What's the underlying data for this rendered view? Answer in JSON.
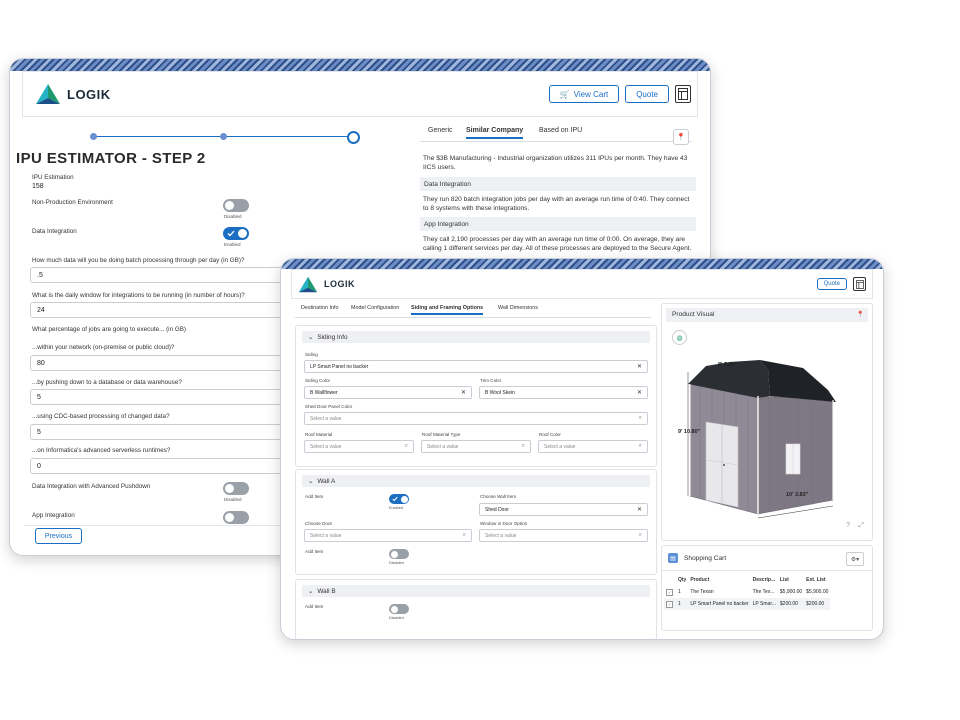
{
  "win1": {
    "brand": "LOGIK",
    "view_cart_label": "View Cart",
    "quote_label": "Quote",
    "title": "IPU ESTIMATOR - STEP 2",
    "ipu_estimation": {
      "label": "IPU Estimation",
      "value": "158"
    },
    "non_prod": {
      "label": "Non-Production Environment",
      "state": "Disabled"
    },
    "data_integration": {
      "label": "Data Integration",
      "state": "Enabled"
    },
    "q1": {
      "label": "How much data will you be doing batch processing through per day (in GB)?",
      "value": ".5"
    },
    "q2": {
      "label": "What is the daily window for integrations to be running (in number of hours)?",
      "value": "24"
    },
    "q3_label": "What percentage of jobs are going to execute... (in GB)",
    "q4": {
      "label": "...within your network (on-premise or public cloud)?",
      "value": "80"
    },
    "q5": {
      "label": "...by pushing down to a database or data warehouse?",
      "value": "5"
    },
    "q6": {
      "label": "...using CDC-based processing of changed data?",
      "value": "5"
    },
    "q7": {
      "label": "...on Informatica's advanced serverless runtimes?",
      "value": "0"
    },
    "adv_pushdown": {
      "label": "Data Integration with Advanced Pushdown",
      "state": "Disabled"
    },
    "app_integration_label": "App Integration",
    "previous_label": "Previous",
    "tabs": [
      "Generic",
      "Similar Company",
      "Based on IPU"
    ],
    "intro": "The $3B Manufacturing - Industrial organization utilizes 311 IPUs per month. They have 43 IICS users.",
    "sec_data_integration": "Data Integration",
    "data_integration_text": "They run 820 batch integration jobs per day with an average run time of 0:40. They connect to 8 systems with these integrations.",
    "sec_app_integration": "App Integration",
    "app_integration_text": "They call 2,190 processes per day with an average run time of 0:00. On average, they are calling 1 different services per day. All of these processes are deployed to the Secure Agent."
  },
  "win2": {
    "brand": "LOGIK",
    "quote_label": "Quote",
    "tabs": [
      "Destination Info",
      "Model Configuration",
      "Siding and Framing Options",
      "Wall Dimensions"
    ],
    "siding_info": {
      "header": "Siding Info",
      "siding_label": "Siding",
      "siding_value": "LP Smart Panel no backer",
      "siding_color_label": "Siding Color",
      "siding_color_value": "B Wallflower",
      "trim_color_label": "Trim Color",
      "trim_color_value": "B Wool Skein",
      "shed_door_label": "Shed Door Panel Color",
      "roof_material_label": "Roof Material",
      "roof_material_type_label": "Roof Material Type",
      "roof_color_label": "Roof Color"
    },
    "placeholder": "Select a value",
    "wall_a": {
      "header": "Wall A",
      "add_item_label": "Add Item",
      "add_item_state": "Enabled",
      "choose_wall_item_label": "Choose Wall Item",
      "choose_wall_item_value": "Shed Door",
      "choose_door_label": "Choose Door",
      "window_label": "Window in Door Option",
      "add_item2_label": "Add Item",
      "add_item2_state": "Disabled"
    },
    "wall_b": {
      "header": "Wall B",
      "add_item_label": "Add Item",
      "add_item_state": "Disabled"
    },
    "product_visual": {
      "title": "Product Visual",
      "dim_top": "8' 7.25\"",
      "dim_left": "9' 10.80\"",
      "dim_bottom": "10' 3.83\""
    },
    "cart": {
      "title": "Shopping Cart",
      "columns": [
        "Qty",
        "Product",
        "Descrip...",
        "List",
        "Ext. List"
      ],
      "rows": [
        [
          "1",
          "The Texan",
          "The Tex...",
          "$5,900.00",
          "$5,900.00"
        ],
        [
          "1",
          "LP Smart Panel no backer",
          "LP Smar...",
          "$200.00",
          "$200.00"
        ]
      ]
    }
  },
  "colors": {
    "accent": "#1b6ec2",
    "shed_wall": "#8f8a96",
    "shed_roof": "#2b2e33"
  }
}
